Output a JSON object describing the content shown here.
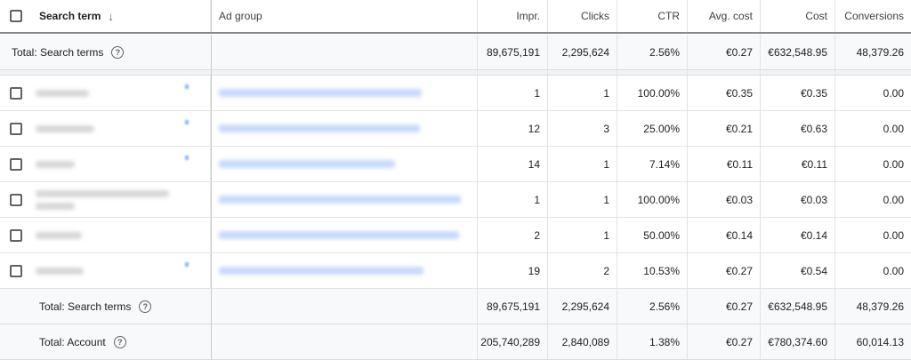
{
  "header": {
    "search_term": "Search term",
    "ad_group": "Ad group",
    "impr": "Impr.",
    "clicks": "Clicks",
    "ctr": "CTR",
    "avg_cost": "Avg. cost",
    "cost": "Cost",
    "conversions": "Conversions"
  },
  "total_top": {
    "label": "Total: Search terms",
    "impr": "89,675,191",
    "clicks": "2,295,624",
    "ctr": "2.56%",
    "avg_cost": "€0.27",
    "cost": "€632,548.95",
    "conversions": "48,379.26"
  },
  "rows": [
    {
      "impr": "1",
      "clicks": "1",
      "ctr": "100.00%",
      "avg_cost": "€0.35",
      "cost": "€0.35",
      "conversions": "0.00"
    },
    {
      "impr": "12",
      "clicks": "3",
      "ctr": "25.00%",
      "avg_cost": "€0.21",
      "cost": "€0.63",
      "conversions": "0.00"
    },
    {
      "impr": "14",
      "clicks": "1",
      "ctr": "7.14%",
      "avg_cost": "€0.11",
      "cost": "€0.11",
      "conversions": "0.00"
    },
    {
      "impr": "1",
      "clicks": "1",
      "ctr": "100.00%",
      "avg_cost": "€0.03",
      "cost": "€0.03",
      "conversions": "0.00"
    },
    {
      "impr": "2",
      "clicks": "1",
      "ctr": "50.00%",
      "avg_cost": "€0.14",
      "cost": "€0.14",
      "conversions": "0.00"
    },
    {
      "impr": "19",
      "clicks": "2",
      "ctr": "10.53%",
      "avg_cost": "€0.27",
      "cost": "€0.54",
      "conversions": "0.00"
    }
  ],
  "footer": [
    {
      "label": "Total: Search terms",
      "impr": "89,675,191",
      "clicks": "2,295,624",
      "ctr": "2.56%",
      "avg_cost": "€0.27",
      "cost": "€632,548.95",
      "conversions": "48,379.26"
    },
    {
      "label": "Total: Account",
      "impr": "205,740,289",
      "clicks": "2,840,089",
      "ctr": "1.38%",
      "avg_cost": "€0.27",
      "cost": "€780,374.60",
      "conversions": "60,014.13"
    }
  ],
  "icons": {
    "sort": "arrow-down-icon",
    "help": "help-circle-icon",
    "checkbox": "checkbox-icon"
  },
  "colors": {
    "link_blur": "#c6d9fb",
    "total_bg": "#f8f9fa"
  }
}
